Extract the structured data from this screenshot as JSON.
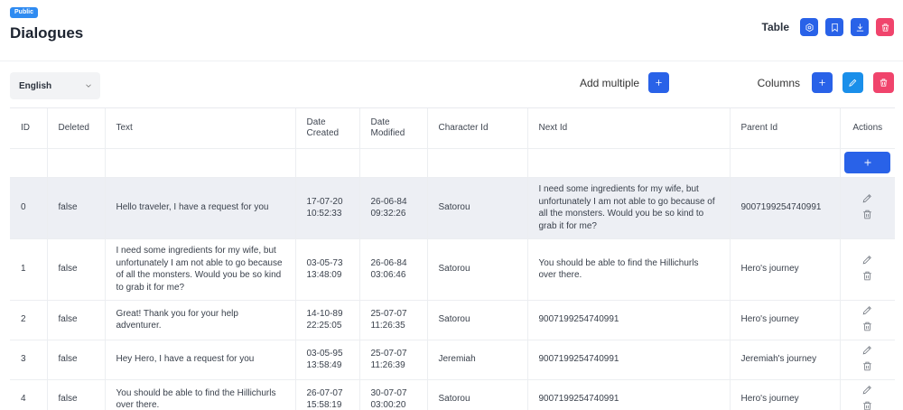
{
  "header": {
    "badge": "Public",
    "title": "Dialogues",
    "table_label": "Table"
  },
  "toolbar": {
    "language": "English",
    "add_multiple_label": "Add multiple",
    "columns_label": "Columns"
  },
  "table": {
    "columns": [
      {
        "key": "id",
        "label": "ID"
      },
      {
        "key": "deleted",
        "label": "Deleted"
      },
      {
        "key": "text",
        "label": "Text"
      },
      {
        "key": "date_created",
        "label": "Date Created"
      },
      {
        "key": "date_modified",
        "label": "Date Modified"
      },
      {
        "key": "character_id",
        "label": "Character Id"
      },
      {
        "key": "next_id",
        "label": "Next Id"
      },
      {
        "key": "parent_id",
        "label": "Parent Id"
      },
      {
        "key": "actions",
        "label": "Actions"
      }
    ],
    "rows": [
      {
        "id": "0",
        "deleted": "false",
        "text": "Hello traveler, I have a request for you",
        "date_created": "17-07-20 10:52:33",
        "date_modified": "26-06-84 09:32:26",
        "character_id": "Satorou",
        "next_id": "I need some ingredients for my wife, but unfortunately I am not able to go because of all the monsters. Would you be so kind to grab it for me?",
        "parent_id": "9007199254740991"
      },
      {
        "id": "1",
        "deleted": "false",
        "text": "I need some ingredients for my wife, but unfortunately I am not able to go because of all the monsters. Would you be so kind to grab it for me?",
        "date_created": "03-05-73 13:48:09",
        "date_modified": "26-06-84 03:06:46",
        "character_id": "Satorou",
        "next_id": "You should be able to find the Hillichurls over there.",
        "parent_id": "Hero's journey"
      },
      {
        "id": "2",
        "deleted": "false",
        "text": "Great! Thank you for your help adventurer.",
        "date_created": "14-10-89 22:25:05",
        "date_modified": "25-07-07 11:26:35",
        "character_id": "Satorou",
        "next_id": "9007199254740991",
        "parent_id": "Hero's journey"
      },
      {
        "id": "3",
        "deleted": "false",
        "text": "Hey Hero, I have a request for you",
        "date_created": "03-05-95 13:58:49",
        "date_modified": "25-07-07 11:26:39",
        "character_id": "Jeremiah",
        "next_id": "9007199254740991",
        "parent_id": "Jeremiah's journey"
      },
      {
        "id": "4",
        "deleted": "false",
        "text": "You should be able to find the Hillichurls over there.",
        "date_created": "26-07-07 15:58:19",
        "date_modified": "30-07-07 03:00:20",
        "character_id": "Satorou",
        "next_id": "9007199254740991",
        "parent_id": "Hero's journey"
      }
    ]
  },
  "icons": {
    "settings": "gear-icon",
    "bookmark": "bookmark-icon",
    "download": "download-icon",
    "delete": "trash-icon",
    "add": "plus-icon",
    "edit": "pencil-icon"
  },
  "colors": {
    "primary": "#2962e8",
    "sky": "#1a8fea",
    "danger": "#f0446c",
    "badge": "#2f8bf1",
    "row_highlight": "#edeff4"
  }
}
